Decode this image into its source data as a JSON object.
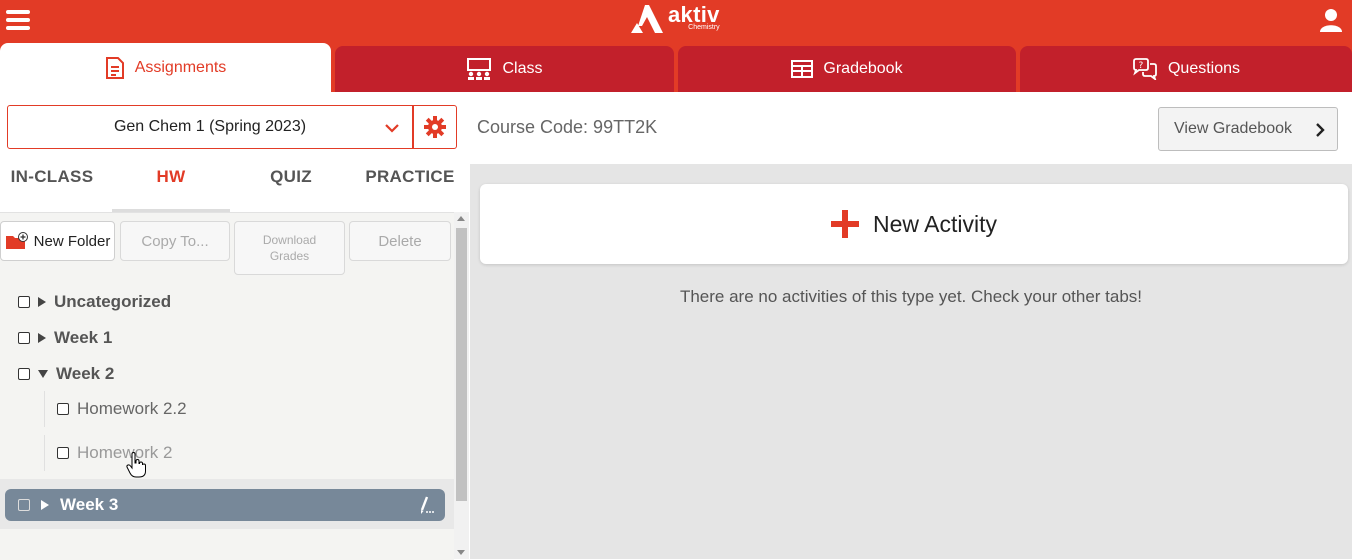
{
  "brand": {
    "name": "aktiv",
    "subtitle": "Chemistry",
    "color": "#e23b26"
  },
  "nav_tabs": [
    {
      "label": "Assignments",
      "icon": "document-icon",
      "active": true
    },
    {
      "label": "Class",
      "icon": "class-icon",
      "active": false
    },
    {
      "label": "Gradebook",
      "icon": "table-icon",
      "active": false
    },
    {
      "label": "Questions",
      "icon": "chat-question-icon",
      "active": false
    }
  ],
  "course": {
    "selected": "Gen Chem 1 (Spring 2023)",
    "code_label": "Course Code: 99TT2K"
  },
  "view_gradebook_label": "View Gradebook",
  "type_tabs": [
    {
      "label": "IN-CLASS",
      "active": false
    },
    {
      "label": "HW",
      "active": true
    },
    {
      "label": "QUIZ",
      "active": false
    },
    {
      "label": "PRACTICE",
      "active": false
    }
  ],
  "toolbar": {
    "new_folder": "New Folder",
    "copy_to": "Copy To...",
    "download_grades_line1": "Download",
    "download_grades_line2": "Grades",
    "delete": "Delete"
  },
  "folders": [
    {
      "label": "Uncategorized",
      "expanded": false
    },
    {
      "label": "Week 1",
      "expanded": false
    },
    {
      "label": "Week 2",
      "expanded": true,
      "children": [
        "Homework 2.2",
        "Homework 2"
      ]
    },
    {
      "label": "Week 3",
      "expanded": false,
      "selected": true
    }
  ],
  "new_activity_label": "New Activity",
  "empty_message": "There are no activities of this type yet. Check your other tabs!"
}
